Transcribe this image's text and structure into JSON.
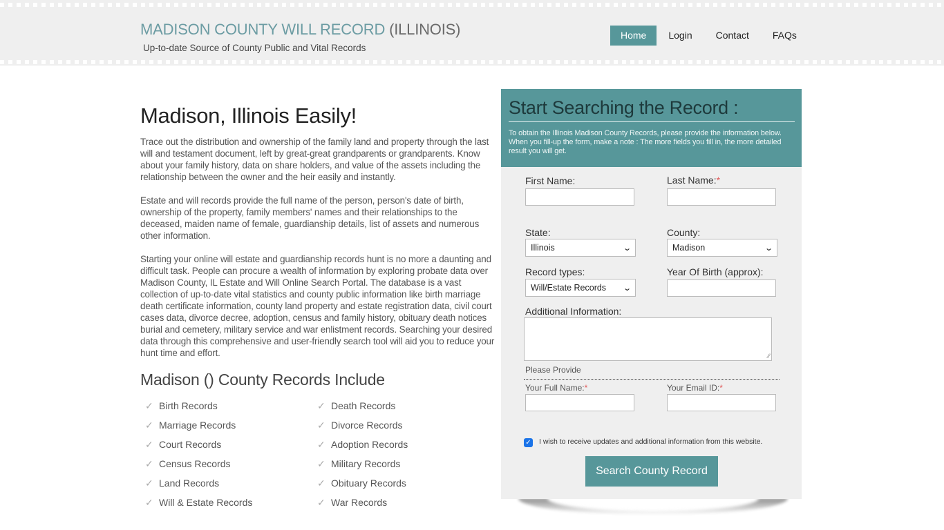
{
  "header": {
    "site_title_main": "MADISON COUNTY WILL RECORD",
    "site_title_state": "(ILLINOIS)",
    "tagline": "Up-to-date Source of  County Public and Vital Records",
    "nav": [
      {
        "label": "Home",
        "active": true
      },
      {
        "label": "Login",
        "active": false
      },
      {
        "label": "Contact",
        "active": false
      },
      {
        "label": "FAQs",
        "active": false
      }
    ]
  },
  "main": {
    "title": "Madison, Illinois Easily!",
    "paragraphs": [
      "Trace out the distribution and ownership of the family land and property through the last will and testament document, left by great-great grandparents or grandparents. Know about your family history, data on share holders, and value of the assets including the relationship between the owner and the heir easily and instantly.",
      "Estate and will records provide the full name of the person, person's date of birth, ownership of the property, family members' names and their relationships to the deceased, maiden name of female, guardianship details, list of assets and numerous other information.",
      "Starting your online will estate and guardianship records hunt is no more a daunting and difficult task. People can procure a wealth of information by exploring probate data over Madison County, IL Estate and Will Online Search Portal. The database is a vast collection of up-to-date vital statistics and county public information like birth marriage death certificate information, county land property and estate registration data, civil court cases data, divorce decree, adoption, census and family history, obituary death notices burial and cemetery, military service and war enlistment records. Searching your desired data through this comprehensive and user-friendly search tool will aid you to reduce your hunt time and effort."
    ],
    "records_title": "Madison () County Records Include",
    "records_icon": "check-icon",
    "records": [
      "Birth Records",
      "Death Records",
      "Marriage Records",
      "Divorce Records",
      "Court Records",
      "Adoption Records",
      "Census Records",
      "Military Records",
      "Land Records",
      "Obituary Records",
      "Will & Estate Records",
      "War Records"
    ]
  },
  "search": {
    "title": "Start Searching the Record :",
    "description": "To obtain the Illinois Madison County Records, please provide the information below. When you fill-up the form, make a note : The more fields you fill in, the more detailed result you will get.",
    "first_name_label": "First Name:",
    "first_name_value": "",
    "last_name_label": "Last Name:",
    "last_name_value": "",
    "required_mark": "*",
    "state_label": "State:",
    "state_value": "Illinois",
    "county_label": "County:",
    "county_value": "Madison",
    "record_types_label": "Record types:",
    "record_types_value": "Will/Estate Records",
    "year_of_birth_label": "Year Of Birth (approx):",
    "year_of_birth_value": "",
    "additional_info_label": "Additional Information:",
    "additional_info_value": "",
    "please_provide": "Please Provide",
    "full_name_label": "Your Full Name:",
    "full_name_value": "",
    "email_label": "Your Email ID:",
    "email_value": "",
    "updates_checked": true,
    "updates_label": "I wish to receive updates and additional information from this website.",
    "submit_label": "Search County Record"
  },
  "colors": {
    "accent": "#57979a",
    "title_accent": "#6c9ca3",
    "required": "#e05a5a",
    "header_bg": "#efefef"
  }
}
